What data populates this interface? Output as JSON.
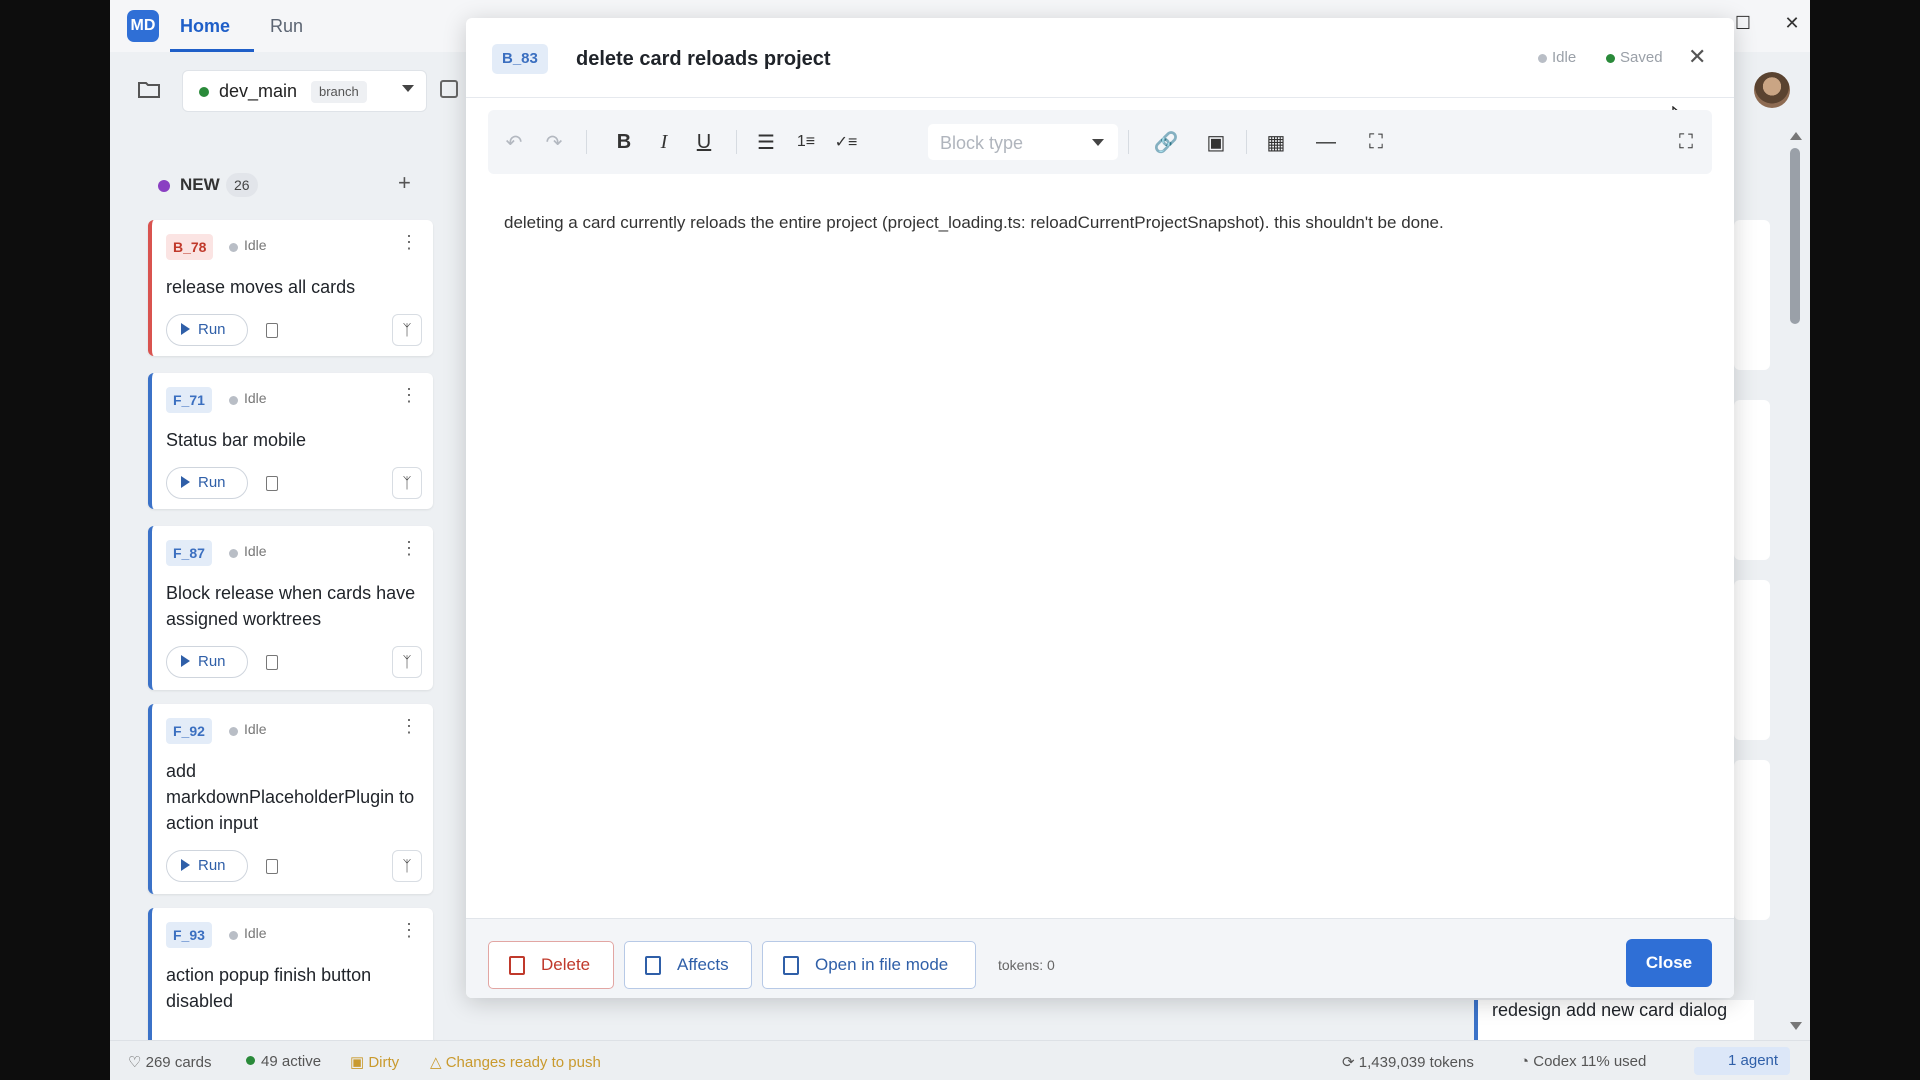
{
  "app": {
    "logo": "MD",
    "tabs": [
      "Home",
      "Run"
    ]
  },
  "branch": {
    "name": "dev_main",
    "tag": "branch"
  },
  "column": {
    "title": "NEW",
    "count": "26",
    "add_label": "+"
  },
  "cards": [
    {
      "id": "B_78",
      "status": "Idle",
      "title": "release moves all cards",
      "run_label": "Run"
    },
    {
      "id": "F_71",
      "status": "Idle",
      "title": "Status bar mobile",
      "run_label": "Run"
    },
    {
      "id": "F_87",
      "status": "Idle",
      "title": "Block release when cards have assigned worktrees",
      "run_label": "Run"
    },
    {
      "id": "F_92",
      "status": "Idle",
      "title": "add markdownPlaceholderPlugin to action input",
      "run_label": "Run"
    },
    {
      "id": "F_93",
      "status": "Idle",
      "title": "action popup finish button disabled",
      "run_label": "Run"
    }
  ],
  "background_card": {
    "title": "redesign add new card dialog"
  },
  "modal": {
    "id": "B_83",
    "title": "delete card reloads project",
    "run_status": "Idle",
    "save_status": "Saved",
    "toolbar": {
      "block_type_placeholder": "Block type"
    },
    "body": "deleting a card currently reloads the entire project (project_loading.ts: reloadCurrentProjectSnapshot). this shouldn't be done.",
    "footer": {
      "delete_label": "Delete",
      "affects_label": "Affects",
      "open_file_label": "Open in file mode",
      "tokens": "tokens: 0",
      "close_label": "Close"
    }
  },
  "statusbar": {
    "cards": "269 cards",
    "active": "49 active",
    "dirty": "Dirty",
    "push": "Changes ready to push",
    "tokens": "1,439,039 tokens",
    "codex": "Codex 11% used",
    "agents": "1 agent"
  },
  "colors": {
    "accent": "#2f6fd6",
    "danger": "#c0392b",
    "status_green": "#2a8a3a",
    "new_column": "#8a3fc2"
  }
}
